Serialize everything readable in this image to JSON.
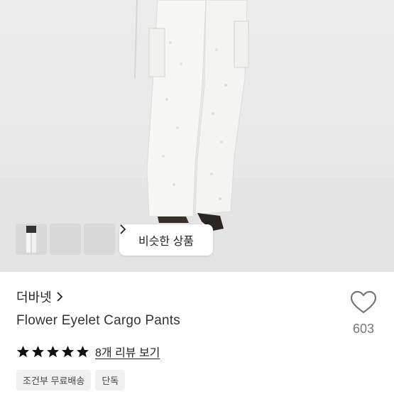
{
  "hero": {
    "image": "white-eyelet-cargo-pants-photo",
    "thumbnails": [
      "thumb-1",
      "thumb-2",
      "thumb-3"
    ],
    "similar_label": "비슷한 상품",
    "similar_icon": "chevron-right-icon"
  },
  "product": {
    "brand": "더바넷",
    "brand_icon": "chevron-right-icon",
    "title": "Flower Eyelet Cargo Pants",
    "likes": "603",
    "like_icon": "heart-outline-icon",
    "rating_stars": 5,
    "review_link": "8개 리뷰 보기",
    "badges": [
      "조건부 무료배송",
      "단독"
    ]
  },
  "colors": {
    "text": "#222222",
    "muted": "#777777",
    "badge_bg": "#f1f1f1"
  }
}
